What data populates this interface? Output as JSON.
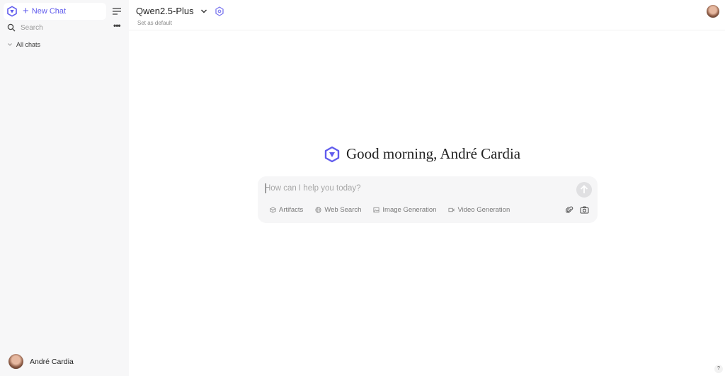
{
  "sidebar": {
    "new_chat_label": "New Chat",
    "search_placeholder": "Search",
    "more_label": "•••",
    "all_chats_label": "All chats",
    "user_name": "André Cardia"
  },
  "header": {
    "model_name": "Qwen2.5-Plus",
    "set_default_label": "Set as default"
  },
  "main": {
    "greeting": "Good morning, André Cardia",
    "input_placeholder": "How can I help you today?",
    "tools": [
      {
        "label": "Artifacts",
        "icon": "cube-icon"
      },
      {
        "label": "Web Search",
        "icon": "globe-icon"
      },
      {
        "label": "Image Generation",
        "icon": "image-icon"
      },
      {
        "label": "Video Generation",
        "icon": "video-icon"
      }
    ]
  },
  "help_label": "?",
  "colors": {
    "accent": "#615ced",
    "sidebar_bg": "#f7f7f8",
    "composer_bg": "#f6f6f7"
  }
}
